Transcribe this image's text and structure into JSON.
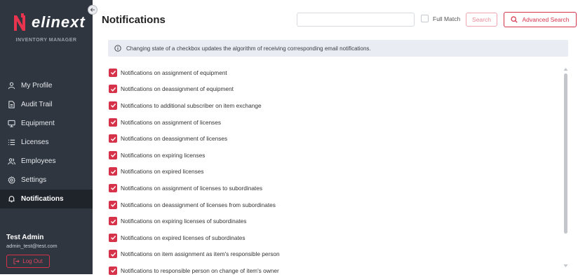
{
  "sidebar": {
    "brand": "elinext",
    "subtitle": "INVENTORY MANAGER",
    "items": [
      {
        "label": "My Profile",
        "icon": "person-icon"
      },
      {
        "label": "Audit Trail",
        "icon": "document-icon"
      },
      {
        "label": "Equipment",
        "icon": "monitor-icon"
      },
      {
        "label": "Licenses",
        "icon": "list-icon"
      },
      {
        "label": "Employees",
        "icon": "people-icon"
      },
      {
        "label": "Settings",
        "icon": "gear-icon"
      },
      {
        "label": "Notifications",
        "icon": "bell-icon",
        "active": true
      }
    ],
    "user": {
      "name": "Test Admin",
      "email": "admin_test@test.com"
    },
    "logout_label": "Log Out"
  },
  "header": {
    "title": "Notifications",
    "search": {
      "value": "",
      "placeholder": ""
    },
    "full_match_label": "Full Match",
    "full_match_checked": false,
    "search_button": "Search",
    "advanced_search_button": "Advanced Search"
  },
  "info_text": "Changing state of a checkbox updates the algorithm of receiving corresponding email notifications.",
  "notifications": [
    {
      "label": "Notifications on assignment of equipment",
      "checked": true
    },
    {
      "label": "Notifications on deassignment of equipment",
      "checked": true
    },
    {
      "label": "Notifications to additional subscriber on item exchange",
      "checked": true
    },
    {
      "label": "Notifications on assignment of licenses",
      "checked": true
    },
    {
      "label": "Notifications on deassignment of licenses",
      "checked": true
    },
    {
      "label": "Notifications on expiring licenses",
      "checked": true
    },
    {
      "label": "Notifications on expired licenses",
      "checked": true
    },
    {
      "label": "Notifications on assignment of licenses to subordinates",
      "checked": true
    },
    {
      "label": "Notifications on deassignment of licenses from subordinates",
      "checked": true
    },
    {
      "label": "Notifications on expiring licenses of subordinates",
      "checked": true
    },
    {
      "label": "Notifications on expired licenses of subordinates",
      "checked": true
    },
    {
      "label": "Notifications on item assignment as item's responsible person",
      "checked": true
    },
    {
      "label": "Notifications to responsible person on change of item's owner",
      "checked": true
    }
  ],
  "colors": {
    "accent": "#d6324a",
    "sidebar_bg": "#2f3640",
    "sidebar_active": "#1f242b",
    "info_bg": "#e9ecf2"
  }
}
